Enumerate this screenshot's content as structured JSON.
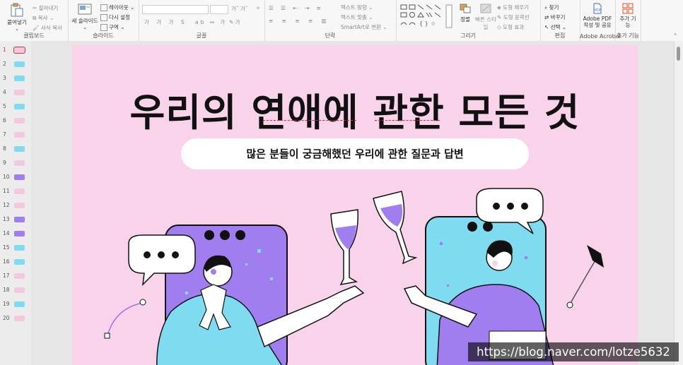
{
  "ribbon": {
    "clipboard": {
      "paste": "붙여넣기",
      "cut": "잘라내기",
      "copy": "복사",
      "format_painter": "서식 복사",
      "label": "클립보드"
    },
    "slides": {
      "new_slide": "새 슬라이드",
      "layout": "레이아웃",
      "reset": "다시 설정",
      "section": "구역",
      "label": "슬라이드"
    },
    "font": {
      "label": "글꼴"
    },
    "paragraph": {
      "text_direction": "텍스트 방향",
      "align_text": "텍스트 맞춤",
      "smartart": "SmartArt로 변환",
      "label": "단락"
    },
    "drawing": {
      "arrange": "정렬",
      "quick_styles": "빠른 스타일",
      "shape_fill": "도형 채우기",
      "shape_outline": "도형 윤곽선",
      "shape_effects": "도형 효과",
      "label": "그리기"
    },
    "editing": {
      "find": "찾기",
      "replace": "바꾸기",
      "select": "선택",
      "label": "편집"
    },
    "acrobat": {
      "create": "Adobe PDF 작성 및 공유",
      "label": "Adobe Acrobat"
    },
    "addins": {
      "button": "추가 기능",
      "label": "추가 기능"
    }
  },
  "slides_panel": {
    "numbers": [
      "1",
      "2",
      "3",
      "4",
      "5",
      "6",
      "7",
      "8",
      "9",
      "10",
      "11",
      "12",
      "13",
      "14",
      "15",
      "16",
      "17",
      "18",
      "19",
      "20"
    ]
  },
  "slide": {
    "title": "우리의 연애에 관한 모든 것",
    "subtitle": "많은 분들이 궁금해했던 우리에 관한 질문과 답변",
    "colors": {
      "background": "#f9d3ea",
      "purple": "#a07ef0",
      "cyan": "#7fdcf0"
    }
  },
  "watermark": "https://blog.naver.com/lotze5632"
}
